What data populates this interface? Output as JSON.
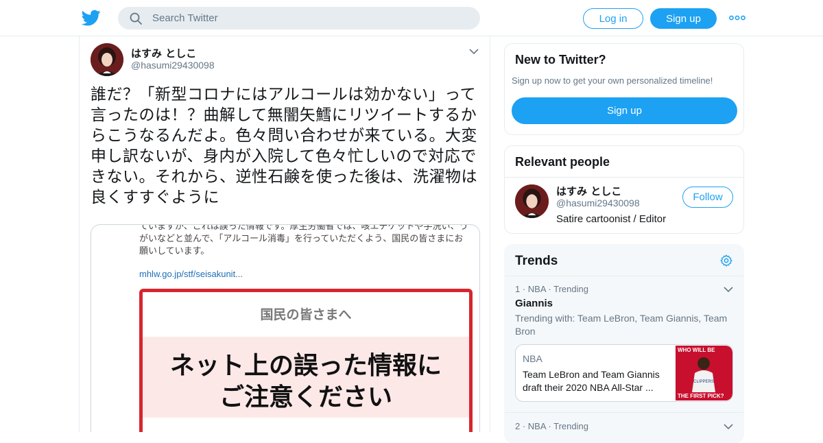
{
  "header": {
    "search_placeholder": "Search Twitter",
    "login_label": "Log in",
    "signup_label": "Sign up",
    "brand_color": "#1da1f2"
  },
  "tweet": {
    "author_name": "はすみ としこ",
    "author_handle": "@hasumi29430098",
    "text": "誰だ？「新型コロナにはアルコールは効かない」って言ったのは！？曲解して無闇矢鱈にリツイートするからこうなるんだよ。色々問い合わせが来ている。大変申し訳ないが、身内が入院して色々忙しいので対応できない。それから、逆性石鹸を使った後は、洗濯物は良くすすぐように",
    "media": {
      "top_text": "ていますが、これは誤った情報です。厚生労働省では、咳エチケットや手洗い、うがいなどと並んで、「アルコール消毒」を行っていただくよう、国民の皆さまにお願いしています。",
      "link": "mhlw.go.jp/stf/seisakunit...",
      "poster_heading": "国民の皆さまへ",
      "poster_line1": "ネット上の誤った情報に",
      "poster_line2": "ご注意ください"
    }
  },
  "new_to_twitter": {
    "title": "New to Twitter?",
    "subtitle": "Sign up now to get your own personalized timeline!",
    "signup_label": "Sign up"
  },
  "relevant_people": {
    "title": "Relevant people",
    "name": "はすみ としこ",
    "handle": "@hasumi29430098",
    "bio": "Satire cartoonist / Editor",
    "follow_label": "Follow"
  },
  "trends": {
    "title": "Trends",
    "items": [
      {
        "meta": "1 · NBA · Trending",
        "name": "Giannis",
        "with": "Trending with: Team LeBron, Team Giannis, Team Bron",
        "news_source": "NBA",
        "news_title": "Team LeBron and Team Giannis draft their 2020 NBA All-Star ...",
        "thumb_top": "WHO WILL BE",
        "thumb_bottom": "THE FIRST PICK?"
      },
      {
        "meta": "2 · NBA · Trending"
      }
    ]
  }
}
